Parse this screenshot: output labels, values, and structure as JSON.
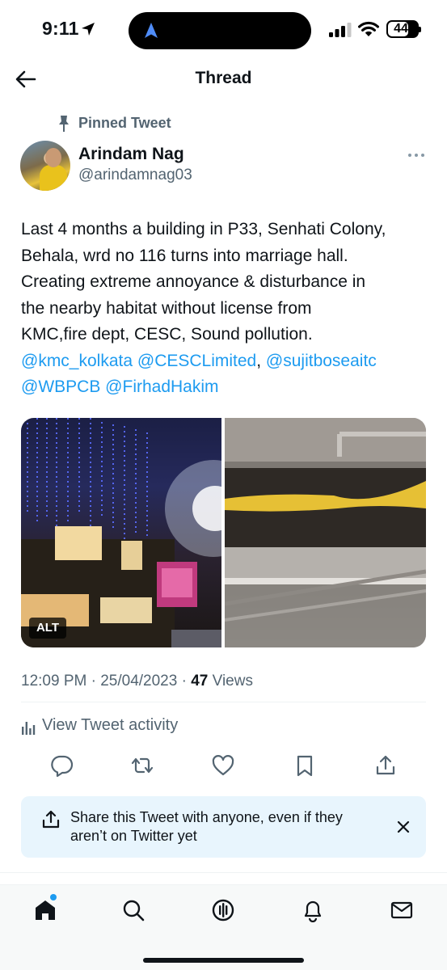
{
  "status_bar": {
    "time": "9:11",
    "battery": "44"
  },
  "header": {
    "title": "Thread"
  },
  "tweet": {
    "pinned_label": "Pinned Tweet",
    "author_name": "Arindam Nag",
    "author_handle": "@arindamnag03",
    "text_lines": [
      "Last 4 months a building in P33, Senhati Colony,",
      "Behala, wrd no 116 turns into marriage hall.",
      "Creating extreme annoyance & disturbance in",
      "the nearby habitat without license from",
      "KMC,fire dept, CESC, Sound pollution."
    ],
    "mentions": {
      "kmc": "@kmc_kolkata",
      "cesc": "@CESCLimited",
      "sep": ", ",
      "sujit": "@sujitboseaitc",
      "wbpcb": "@WBPCB",
      "firhad": "@FirhadHakim"
    },
    "media_alt_badge": "ALT",
    "time": "12:09 PM",
    "date": "25/04/2023",
    "views_count": "47",
    "views_label": "Views",
    "activity_label": "View Tweet activity"
  },
  "share_banner": {
    "text": "Share this Tweet with anyone, even if they aren’t on Twitter yet"
  },
  "colors": {
    "accent": "#1d9bf0",
    "secondary_text": "#536471",
    "primary_text": "#0f1419",
    "banner_bg": "#e8f5fd"
  },
  "icons": {
    "status": [
      "location-arrow-icon",
      "navigation-icon",
      "signal-icon",
      "wifi-icon",
      "battery-icon"
    ],
    "header": [
      "back-arrow-icon"
    ],
    "tweet": [
      "pin-icon",
      "more-icon",
      "analytics-icon"
    ],
    "actions": [
      "reply-icon",
      "retweet-icon",
      "like-icon",
      "bookmark-icon",
      "share-icon"
    ],
    "banner": [
      "share-icon",
      "close-icon"
    ],
    "tabs": [
      "home-icon",
      "search-icon",
      "spaces-icon",
      "notifications-icon",
      "messages-icon"
    ]
  }
}
